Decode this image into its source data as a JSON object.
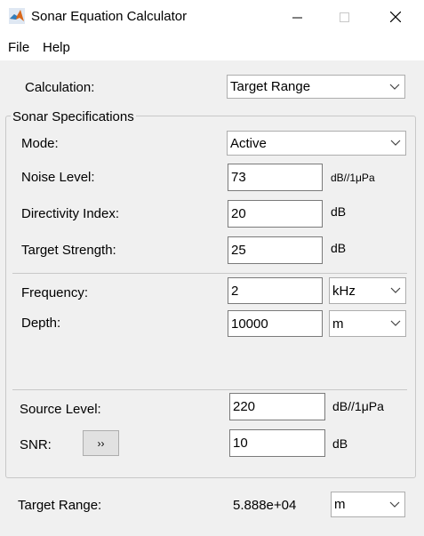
{
  "window": {
    "title": "Sonar Equation Calculator",
    "controls": {
      "minimize": "minimize-icon",
      "maximize": "maximize-icon",
      "close": "close-icon"
    }
  },
  "menu": {
    "file": "File",
    "help": "Help"
  },
  "calculation": {
    "label": "Calculation:",
    "selected": "Target Range"
  },
  "panel": {
    "title": "Sonar Specifications"
  },
  "mode": {
    "label": "Mode:",
    "selected": "Active"
  },
  "noise_level": {
    "label": "Noise Level:",
    "value": "73",
    "unit": "dB//1μPa"
  },
  "directivity_index": {
    "label": "Directivity Index:",
    "value": "20",
    "unit": "dB"
  },
  "target_strength": {
    "label": "Target Strength:",
    "value": "25",
    "unit": "dB"
  },
  "frequency": {
    "label": "Frequency:",
    "value": "2",
    "unit": "kHz"
  },
  "depth": {
    "label": "Depth:",
    "value": "10000",
    "unit": "m"
  },
  "source_level": {
    "label": "Source Level:",
    "value": "220",
    "unit": "dB//1μPa"
  },
  "snr": {
    "label": "SNR:",
    "button": "››",
    "value": "10",
    "unit": "dB"
  },
  "result": {
    "label": "Target Range:",
    "value": "5.888e+04",
    "unit": "m"
  },
  "colors": {
    "window_bg": "#f0f0f0",
    "titlebar_bg": "#ffffff",
    "border": "#7a7a7a"
  }
}
